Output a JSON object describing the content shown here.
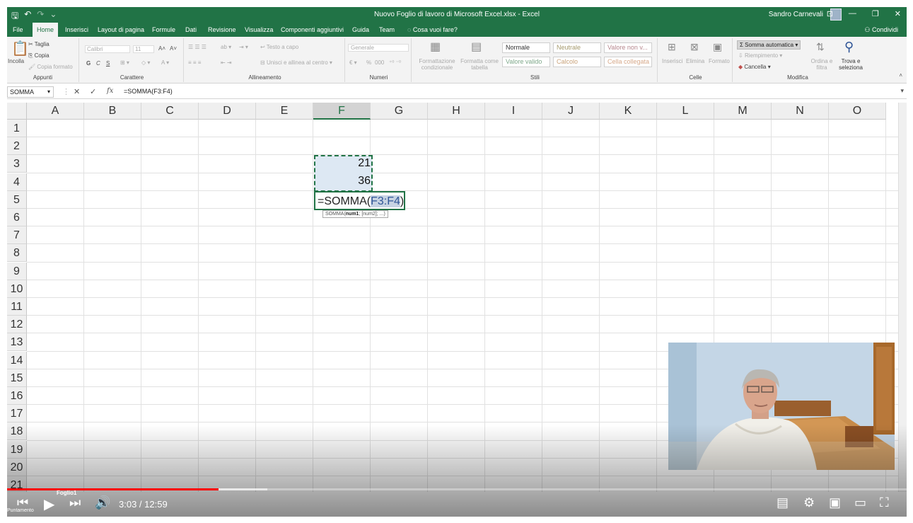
{
  "titlebar": {
    "title": "Nuovo Foglio di lavoro di Microsoft Excel.xlsx  -  Excel",
    "user": "Sandro Carnevali",
    "qat_save": "🖫",
    "qat_undo": "↶",
    "qat_redo": "↷",
    "qat_more": "⌄",
    "btn_ribbon": "⊡",
    "btn_minimize": "—",
    "btn_restore": "❐",
    "btn_close": "✕"
  },
  "tabs": [
    {
      "label": "File"
    },
    {
      "label": "Home"
    },
    {
      "label": "Inserisci"
    },
    {
      "label": "Layout di pagina"
    },
    {
      "label": "Formule"
    },
    {
      "label": "Dati"
    },
    {
      "label": "Revisione"
    },
    {
      "label": "Visualizza"
    },
    {
      "label": "Componenti aggiuntivi"
    },
    {
      "label": "Guida"
    },
    {
      "label": "Team"
    },
    {
      "label": "Cosa vuoi fare?"
    }
  ],
  "share_label": "Condividi",
  "ribbon": {
    "clipboard": {
      "paste": "Incolla",
      "cut": "Taglia",
      "copy": "Copia",
      "format_painter": "Copia formato",
      "label": "Appunti"
    },
    "font": {
      "name": "Calibri",
      "size": "11",
      "grow": "A˄",
      "shrink": "A˅",
      "bold": "G",
      "italic": "C",
      "underline": "S",
      "label": "Carattere"
    },
    "alignment": {
      "wrap": "Testo a capo",
      "merge": "Unisci e allinea al centro",
      "label": "Allineamento"
    },
    "number": {
      "format": "Generale",
      "percent": "%",
      "thousands": "000",
      "label": "Numeri"
    },
    "styles": {
      "conditional": "Formattazione condizionale",
      "table": "Formatta come tabella",
      "normale": "Normale",
      "neutrale": "Neutrale",
      "valore_non_valido": "Valore non v...",
      "valore_valido": "Valore valido",
      "calcolo": "Calcolo",
      "cella_collegata": "Cella collegata",
      "label": "Stili"
    },
    "cells": {
      "insert": "Inserisci",
      "delete": "Elimina",
      "format": "Formato",
      "label": "Celle"
    },
    "editing": {
      "autosum": "Somma automatica",
      "fill": "Riempimento",
      "clear": "Cancella",
      "sort": "Ordina e filtra",
      "find": "Trova e seleziona",
      "label": "Modifica"
    }
  },
  "formula_bar": {
    "name_box": "SOMMA",
    "cancel": "✕",
    "enter": "✓",
    "fx": "fx",
    "formula": "=SOMMA(F3:F4)"
  },
  "columns": [
    "A",
    "B",
    "C",
    "D",
    "E",
    "F",
    "G",
    "H",
    "I",
    "J",
    "K",
    "L",
    "M",
    "N",
    "O"
  ],
  "selected_column": "F",
  "rows": [
    "1",
    "2",
    "3",
    "4",
    "5",
    "6",
    "7",
    "8",
    "9",
    "10",
    "11",
    "12",
    "13",
    "14",
    "15",
    "16",
    "17",
    "18",
    "19",
    "20",
    "21"
  ],
  "cells": {
    "F3": "21",
    "F4": "36",
    "F5_prefix": "=SOMMA(",
    "F5_ref": "F3:F4",
    "F5_suffix": ")"
  },
  "tooltip": {
    "fn": "SOMMA(",
    "arg1": "num1",
    "rest": "; [num2]; ...)"
  },
  "player": {
    "time": "3:03 / 12:59",
    "played_fraction": 0.235,
    "buffered_fraction": 0.289,
    "sheet_tab": "Foglio1",
    "status": "Puntamento"
  }
}
